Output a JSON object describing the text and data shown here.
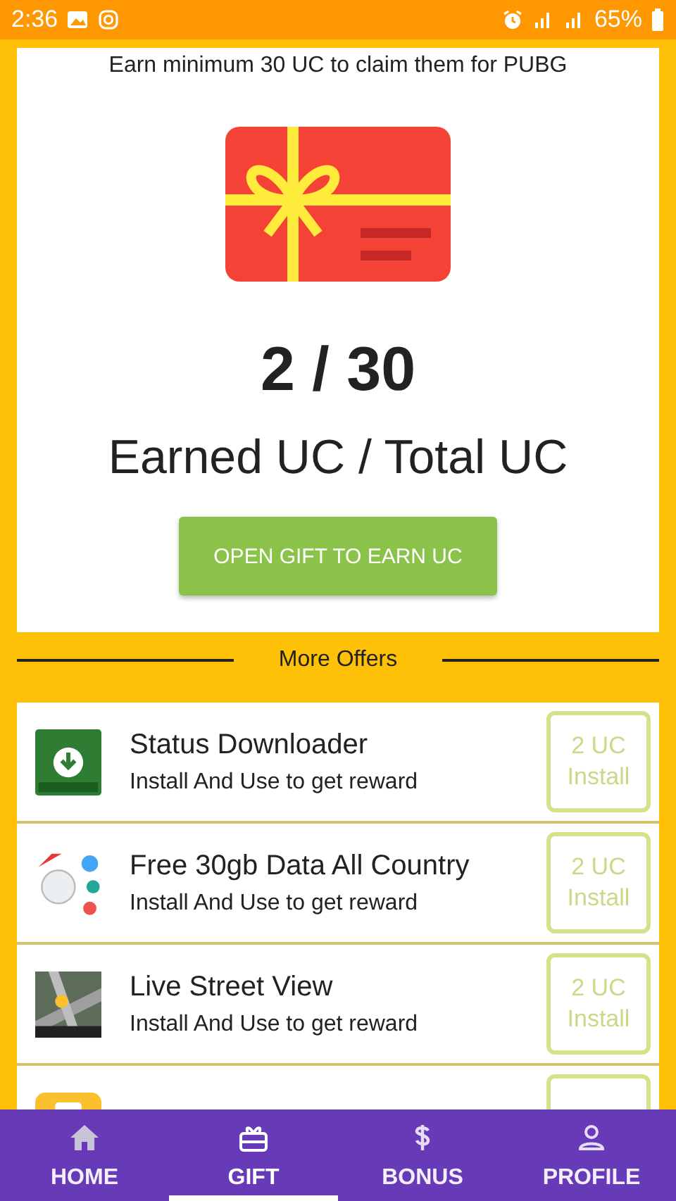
{
  "status_bar": {
    "time": "2:36",
    "battery": "65%"
  },
  "reward": {
    "notice": "Earn minimum 30 UC to claim them for PUBG",
    "progress": "2 / 30",
    "caption": "Earned UC / Total UC",
    "button": "OPEN GIFT TO EARN UC"
  },
  "offers_heading": "More Offers",
  "offers": [
    {
      "kind": "status",
      "title": "Status Downloader",
      "subtitle": "Install And Use to get reward",
      "reward": "2 UC",
      "action": "Install"
    },
    {
      "kind": "data",
      "title": "Free 30gb Data All Country",
      "subtitle": "Install And Use to get reward",
      "reward": "2 UC",
      "action": "Install"
    },
    {
      "kind": "street",
      "title": "Live Street View",
      "subtitle": "Install And Use to get reward",
      "reward": "2 UC",
      "action": "Install"
    },
    {
      "kind": "translate"
    }
  ],
  "nav": [
    {
      "kind": "home",
      "label": "HOME",
      "selected": false
    },
    {
      "kind": "gift",
      "label": "GIFT",
      "selected": true
    },
    {
      "kind": "dollar",
      "label": "BONUS",
      "selected": false
    },
    {
      "kind": "person",
      "label": "PROFILE",
      "selected": false
    }
  ]
}
